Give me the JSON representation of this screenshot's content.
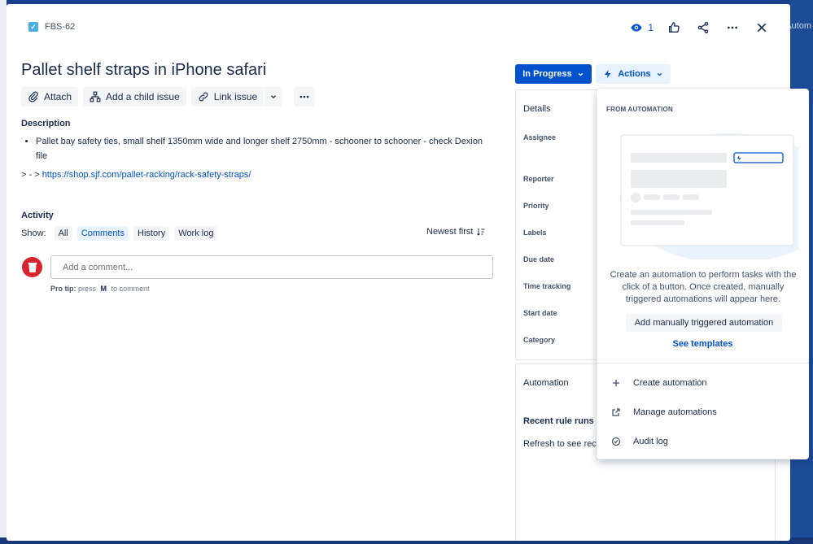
{
  "issue": {
    "key": "FBS-62",
    "title": "Pallet shelf straps in iPhone safari",
    "watch_count": "1"
  },
  "toolbar": {
    "attach": "Attach",
    "add_child": "Add a child issue",
    "link_issue": "Link issue"
  },
  "description": {
    "heading": "Description",
    "bullet": "Pallet bay safety ties, small shelf 1350mm wide and longer shelf 2750mm - schooner to schooner - check Dexion file",
    "link_prefix": "> - > ",
    "link_text": "https://shop.sjf.com/pallet-racking/rack-safety-straps/"
  },
  "activity": {
    "heading": "Activity",
    "show_label": "Show:",
    "filters": [
      "All",
      "Comments",
      "History",
      "Work log"
    ],
    "active_filter": "Comments",
    "sort_label": "Newest first",
    "comment_placeholder": "Add a comment...",
    "protip_label": "Pro tip:",
    "protip_pre": "press",
    "protip_key": "M",
    "protip_post": "to comment"
  },
  "status": {
    "label": "In Progress"
  },
  "actions": {
    "label": "Actions"
  },
  "details": {
    "title": "Details",
    "fields": [
      "Assignee",
      "Reporter",
      "Priority",
      "Labels",
      "Due date",
      "Time tracking",
      "Start date",
      "Category"
    ]
  },
  "automation_panel": {
    "title": "Automation",
    "recent_runs": "Recent rule runs",
    "refresh_text": "Refresh to see rece"
  },
  "dropdown": {
    "heading": "FROM AUTOMATION",
    "description": "Create an automation to perform tasks with the click of a button. Once created, manually triggered automations will appear here.",
    "add_button": "Add manually triggered automation",
    "templates_link": "See templates",
    "items": [
      "Create automation",
      "Manage automations",
      "Audit log"
    ]
  },
  "background": {
    "right_text": "Autom"
  },
  "colors": {
    "primary": "#0052cc",
    "text": "#172b4d",
    "subtle": "#42526e",
    "avatar_red": "#d9232d"
  }
}
